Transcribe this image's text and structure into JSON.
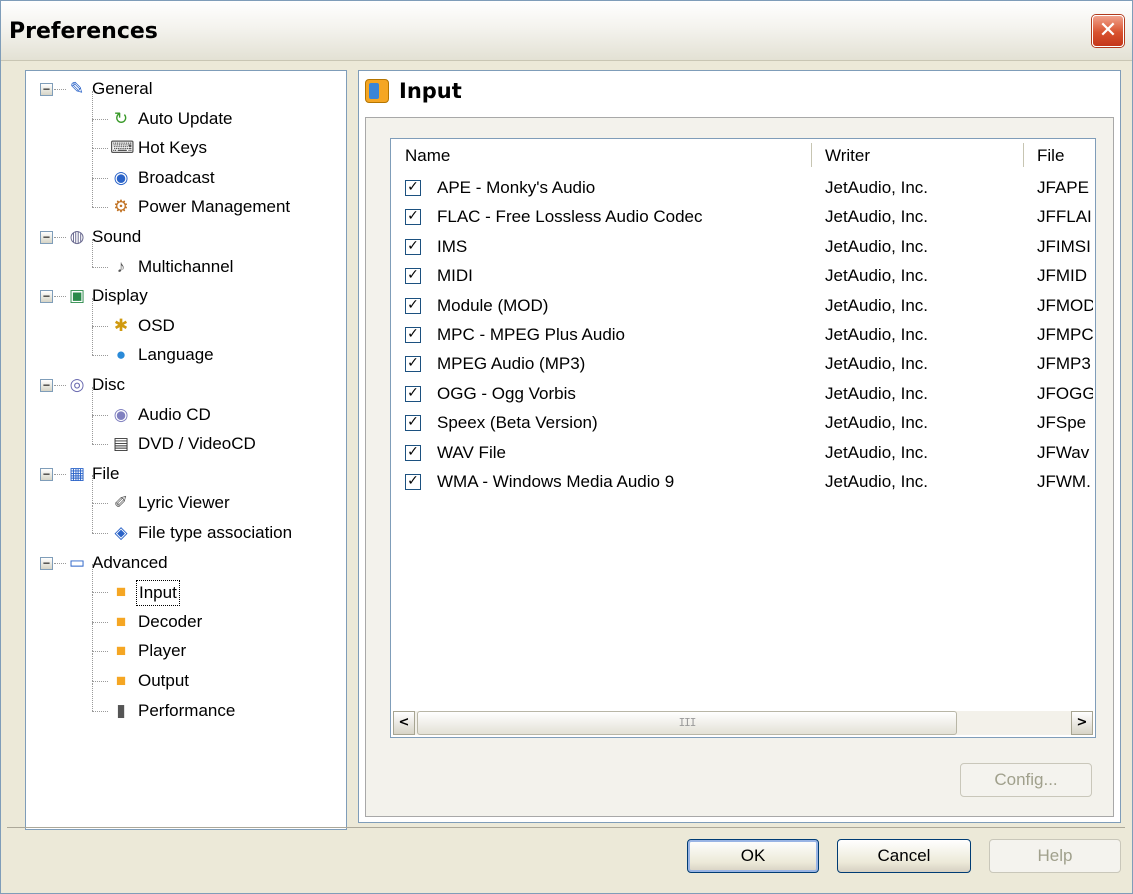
{
  "window": {
    "title": "Preferences",
    "close_glyph": "✕"
  },
  "tree": [
    {
      "label": "General",
      "level": 0,
      "icon": "general-icon",
      "expanded": true
    },
    {
      "label": "Auto Update",
      "level": 1,
      "icon": "auto-update-icon"
    },
    {
      "label": "Hot Keys",
      "level": 1,
      "icon": "keyboard-icon"
    },
    {
      "label": "Broadcast",
      "level": 1,
      "icon": "broadcast-icon"
    },
    {
      "label": "Power Management",
      "level": 1,
      "icon": "power-icon"
    },
    {
      "label": "Sound",
      "level": 0,
      "icon": "sound-icon",
      "expanded": true
    },
    {
      "label": "Multichannel",
      "level": 1,
      "icon": "speaker-icon"
    },
    {
      "label": "Display",
      "level": 0,
      "icon": "display-icon",
      "expanded": true
    },
    {
      "label": "OSD",
      "level": 1,
      "icon": "osd-icon"
    },
    {
      "label": "Language",
      "level": 1,
      "icon": "globe-icon"
    },
    {
      "label": "Disc",
      "level": 0,
      "icon": "disc-icon",
      "expanded": true
    },
    {
      "label": "Audio CD",
      "level": 1,
      "icon": "cd-icon"
    },
    {
      "label": "DVD / VideoCD",
      "level": 1,
      "icon": "dvd-icon"
    },
    {
      "label": "File",
      "level": 0,
      "icon": "file-icon",
      "expanded": true
    },
    {
      "label": "Lyric Viewer",
      "level": 1,
      "icon": "microphone-icon"
    },
    {
      "label": "File type association",
      "level": 1,
      "icon": "file-assoc-icon"
    },
    {
      "label": "Advanced",
      "level": 0,
      "icon": "advanced-icon",
      "expanded": true
    },
    {
      "label": "Input",
      "level": 1,
      "icon": "plugin-icon",
      "selected": true
    },
    {
      "label": "Decoder",
      "level": 1,
      "icon": "plugin-icon"
    },
    {
      "label": "Player",
      "level": 1,
      "icon": "plugin-icon"
    },
    {
      "label": "Output",
      "level": 1,
      "icon": "plugin-icon"
    },
    {
      "label": "Performance",
      "level": 1,
      "icon": "chip-icon"
    }
  ],
  "panel": {
    "title": "Input"
  },
  "list": {
    "columns": [
      "Name",
      "Writer",
      "File"
    ],
    "rows": [
      {
        "checked": true,
        "name": "APE - Monky's Audio",
        "writer": "JetAudio, Inc.",
        "file": "JFAPE"
      },
      {
        "checked": true,
        "name": "FLAC - Free Lossless Audio Codec",
        "writer": "JetAudio, Inc.",
        "file": "JFFLAI"
      },
      {
        "checked": true,
        "name": "IMS",
        "writer": "JetAudio, Inc.",
        "file": "JFIMSI"
      },
      {
        "checked": true,
        "name": "MIDI",
        "writer": "JetAudio, Inc.",
        "file": "JFMID"
      },
      {
        "checked": true,
        "name": "Module (MOD)",
        "writer": "JetAudio, Inc.",
        "file": "JFMOD"
      },
      {
        "checked": true,
        "name": "MPC - MPEG Plus Audio",
        "writer": "JetAudio, Inc.",
        "file": "JFMPC"
      },
      {
        "checked": true,
        "name": "MPEG Audio (MP3)",
        "writer": "JetAudio, Inc.",
        "file": "JFMP3"
      },
      {
        "checked": true,
        "name": "OGG - Ogg Vorbis",
        "writer": "JetAudio, Inc.",
        "file": "JFOGG"
      },
      {
        "checked": true,
        "name": "Speex (Beta Version)",
        "writer": "JetAudio, Inc.",
        "file": "JFSpe"
      },
      {
        "checked": true,
        "name": "WAV File",
        "writer": "JetAudio, Inc.",
        "file": "JFWav"
      },
      {
        "checked": true,
        "name": "WMA - Windows Media Audio 9",
        "writer": "JetAudio, Inc.",
        "file": "JFWM."
      }
    ],
    "scroll_left_glyph": "<",
    "scroll_right_glyph": ">",
    "scroll_thumb_grip": "III"
  },
  "buttons": {
    "config": "Config...",
    "ok": "OK",
    "cancel": "Cancel",
    "help": "Help"
  },
  "colors": {
    "accent_border": "#7f9db9",
    "face": "#ece9d8",
    "close": "#d8522f"
  }
}
